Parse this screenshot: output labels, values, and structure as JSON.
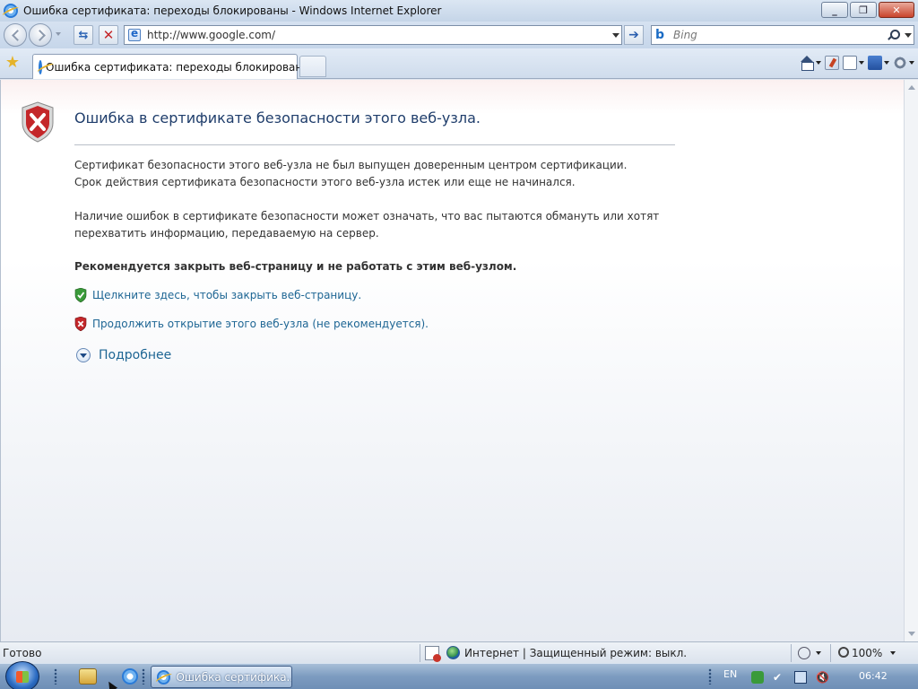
{
  "window": {
    "title": "Ошибка сертификата: переходы блокированы - Windows Internet Explorer",
    "minimize": "_",
    "maximize": "❐",
    "close": "✕"
  },
  "address_bar": {
    "url": "http://www.google.com/",
    "search_placeholder": "Bing"
  },
  "tabs": [
    {
      "label": "Ошибка сертификата: переходы блокированы",
      "active": true
    }
  ],
  "command_bar": {
    "icons": [
      "home-icon",
      "feeds-icon",
      "page-icon",
      "safety-icon",
      "tools-icon"
    ]
  },
  "page": {
    "heading": "Ошибка в сертификате безопасности этого веб-узла.",
    "paragraph1_line1": "Сертификат безопасности этого веб-узла не был выпущен доверенным центром сертификации.",
    "paragraph1_line2": "Срок действия сертификата безопасности этого веб-узла истек или еще не начинался.",
    "paragraph2_line1": "Наличие ошибок в сертификате безопасности может означать, что вас пытаются обмануть или хотят",
    "paragraph2_line2": "перехватить информацию, передаваемую на сервер.",
    "recommendation": "Рекомендуется закрыть веб-страницу и не работать с этим веб-узлом.",
    "close_link": "Щелкните здесь, чтобы закрыть веб-страницу.",
    "continue_link": "Продолжить открытие этого веб-узла (не рекомендуется).",
    "more_info": "Подробнее"
  },
  "status_bar": {
    "status": "Готово",
    "zone": "Интернет | Защищенный режим: выкл.",
    "zoom": "100%"
  },
  "taskbar": {
    "task_label": "Ошибка сертифика...",
    "language": "EN",
    "time": "06:42"
  },
  "colors": {
    "link": "#1e6694",
    "heading": "#1f3d6b",
    "error_shield": "#c4272a",
    "safe_shield": "#3a9a3a"
  }
}
